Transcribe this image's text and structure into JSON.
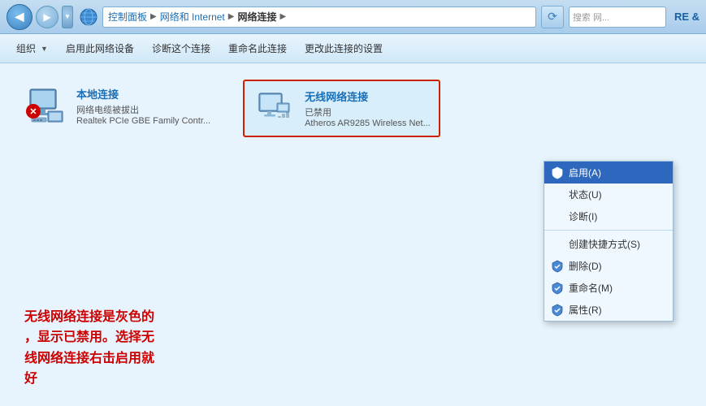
{
  "titlebar": {
    "back_label": "◀",
    "forward_label": "▶",
    "dropdown_label": "▼",
    "breadcrumb": {
      "item1": "控制面板",
      "item2": "网络和 Internet",
      "item3": "网络连接"
    },
    "refresh_label": "⟳",
    "search_placeholder": "搜索 网...",
    "extra_label": "RE &"
  },
  "toolbar": {
    "organize_label": "组织",
    "organize_dropdown": "▼",
    "enable_label": "启用此网络设备",
    "diagnose_label": "诊断这个连接",
    "rename_label": "重命名此连接",
    "change_settings_label": "更改此连接的设置"
  },
  "local_connection": {
    "name": "本地连接",
    "status": "网络电缆被拔出",
    "adapter": "Realtek PCIe GBE Family Contr..."
  },
  "wireless_connection": {
    "name": "无线网络连接",
    "status": "已禁用",
    "adapter": "Atheros AR9285 Wireless Net..."
  },
  "context_menu": {
    "items": [
      {
        "label": "启用(A)",
        "highlighted": true,
        "has_shield": true
      },
      {
        "label": "状态(U)",
        "highlighted": false,
        "has_shield": false
      },
      {
        "label": "诊断(I)",
        "highlighted": false,
        "has_shield": false
      },
      {
        "divider": true
      },
      {
        "label": "创建快捷方式(S)",
        "highlighted": false,
        "has_shield": false
      },
      {
        "label": "删除(D)",
        "highlighted": false,
        "has_shield": true
      },
      {
        "label": "重命名(M)",
        "highlighted": false,
        "has_shield": true
      },
      {
        "label": "属性(R)",
        "highlighted": false,
        "has_shield": true
      }
    ]
  },
  "annotation": {
    "line1": "无线网络连接是灰色的",
    "line2": "，显示已禁用。选择无",
    "line3": "线网络连接右击启用就",
    "line4": "好"
  }
}
